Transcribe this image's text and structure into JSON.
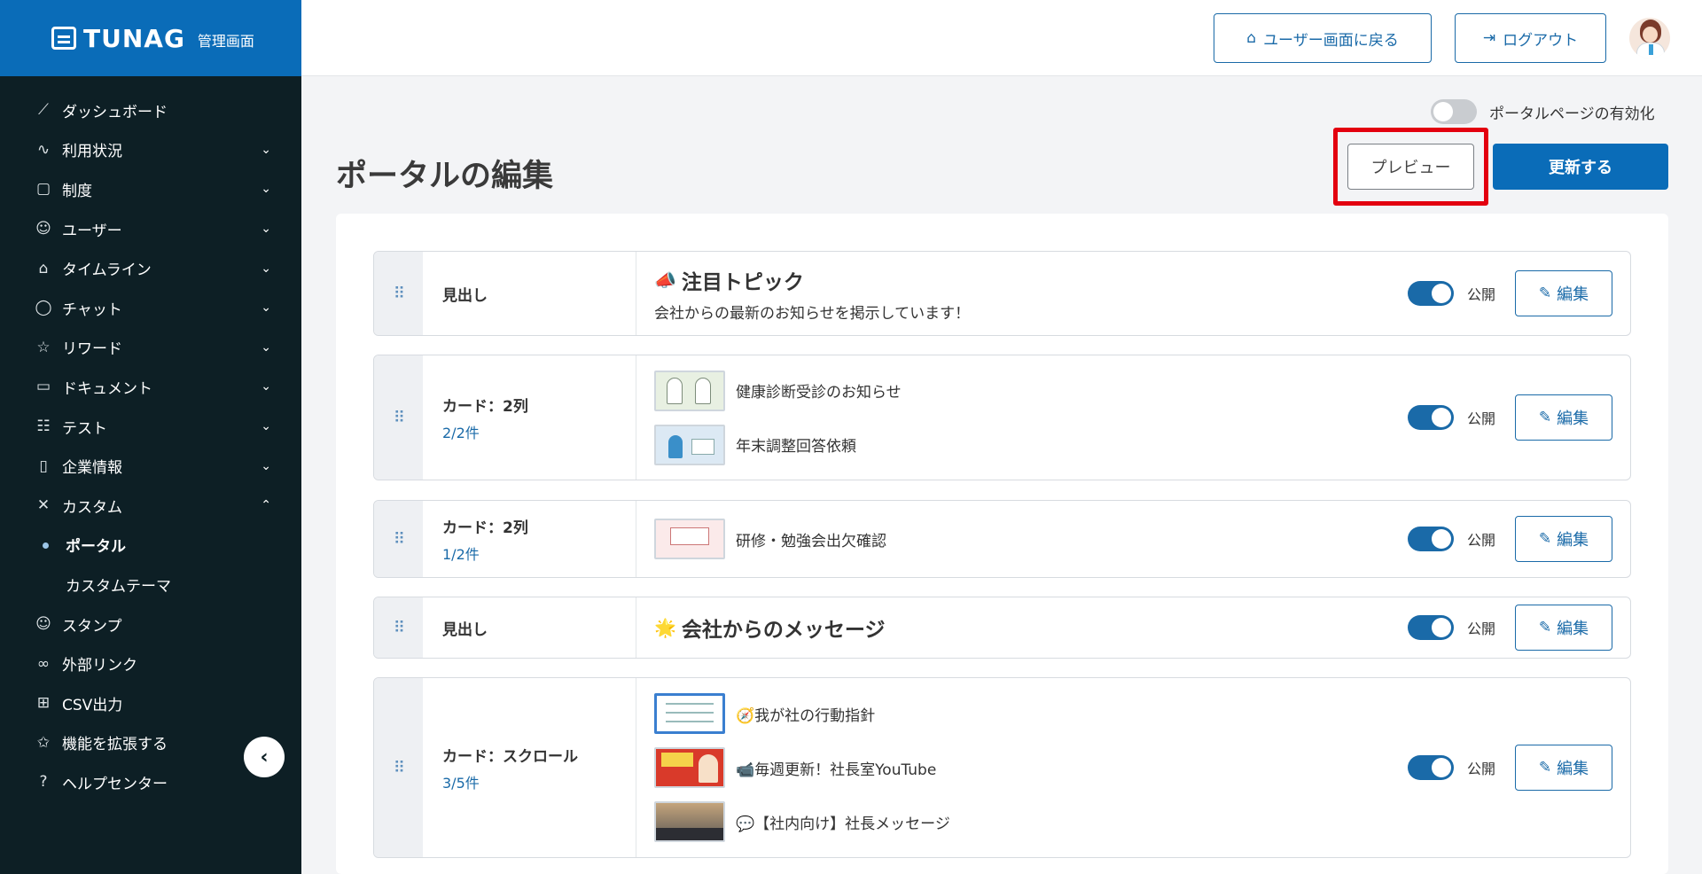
{
  "brand": {
    "name": "TUNAG",
    "subtitle": "管理画面"
  },
  "sidebar": {
    "items": [
      {
        "label": "ダッシュボード",
        "icon": "chart-line-icon"
      },
      {
        "label": "利用状況",
        "icon": "pulse-icon"
      },
      {
        "label": "制度",
        "icon": "book-icon"
      },
      {
        "label": "ユーザー",
        "icon": "users-icon"
      },
      {
        "label": "タイムライン",
        "icon": "home-icon"
      },
      {
        "label": "チャット",
        "icon": "chat-bubble-icon"
      },
      {
        "label": "リワード",
        "icon": "star-icon"
      },
      {
        "label": "ドキュメント",
        "icon": "folder-icon"
      },
      {
        "label": "テスト",
        "icon": "checklist-icon"
      },
      {
        "label": "企業情報",
        "icon": "building-icon"
      },
      {
        "label": "カスタム",
        "icon": "tools-icon"
      },
      {
        "label": "スタンプ",
        "icon": "smile-icon"
      },
      {
        "label": "外部リンク",
        "icon": "link-icon"
      },
      {
        "label": "CSV出力",
        "icon": "table-icon"
      },
      {
        "label": "機能を拡張する",
        "icon": "sparkle-star-icon"
      },
      {
        "label": "ヘルプセンター",
        "icon": "help-icon"
      }
    ],
    "custom_sub": [
      "ポータル",
      "カスタムテーマ"
    ]
  },
  "header": {
    "user_screen_label": "ユーザー画面に戻る",
    "logout_label": "ログアウト"
  },
  "main": {
    "portal_toggle_label": "ポータルページの有効化",
    "portal_enabled": false,
    "title": "ポータルの編集",
    "preview_label": "プレビュー",
    "update_label": "更新する",
    "public_label": "公開",
    "edit_label": "編集",
    "rows": [
      {
        "type": "見出し",
        "heading": "注目トピック",
        "emoji": "📣",
        "subtext": "会社からの最新のお知らせを掲示しています！",
        "public": true
      },
      {
        "type": "カード：2列",
        "count": "2/2件",
        "cards": [
          "健康診断受診のお知らせ",
          "年末調整回答依頼"
        ],
        "public": true
      },
      {
        "type": "カード：2列",
        "count": "1/2件",
        "cards": [
          "研修・勉強会出欠確認"
        ],
        "public": true
      },
      {
        "type": "見出し",
        "heading": "会社からのメッセージ",
        "emoji": "🌟",
        "public": true
      },
      {
        "type": "カード：スクロール",
        "count": "3/5件",
        "cards": [
          "🧭我が社の行動指針",
          "📹毎週更新！社長室YouTube",
          "💬【社内向け】社長メッセージ"
        ],
        "public": true
      }
    ]
  },
  "colors": {
    "brand": "#0a6cb8",
    "sidebar_bg": "#0d1f25",
    "highlight": "#e3000f"
  }
}
